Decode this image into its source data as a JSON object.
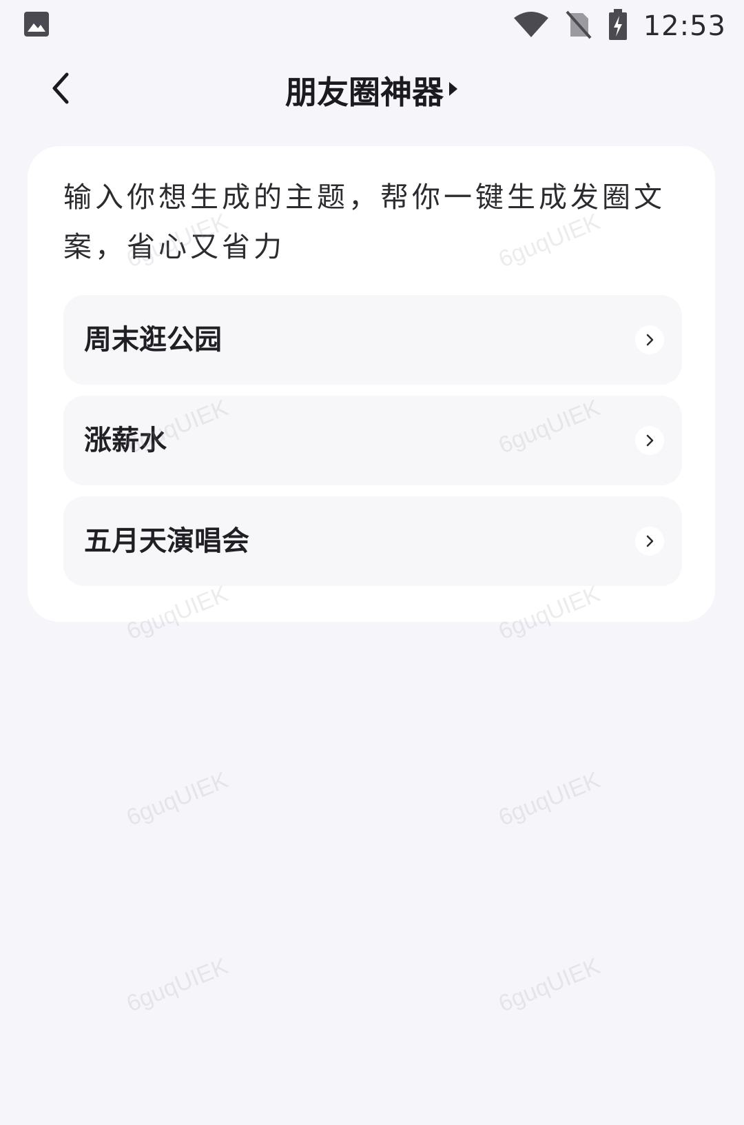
{
  "status_bar": {
    "time": "12:53",
    "icons": [
      "gallery-icon",
      "wifi-icon",
      "no-sim-icon",
      "battery-charging-icon"
    ]
  },
  "nav": {
    "title": "朋友圈神器",
    "back_icon": "back-chevron-icon",
    "title_indicator_icon": "play-triangle-icon"
  },
  "card": {
    "description": "输入你想生成的主题，帮你一键生成发圈文案，省心又省力",
    "topics": [
      {
        "label": "周末逛公园"
      },
      {
        "label": "涨薪水"
      },
      {
        "label": "五月天演唱会"
      }
    ]
  },
  "watermark_text": "6guqUIEK",
  "colors": {
    "background": "#f6f6fa",
    "card": "#ffffff",
    "item": "#f7f7f9",
    "text": "#1f1f24"
  }
}
